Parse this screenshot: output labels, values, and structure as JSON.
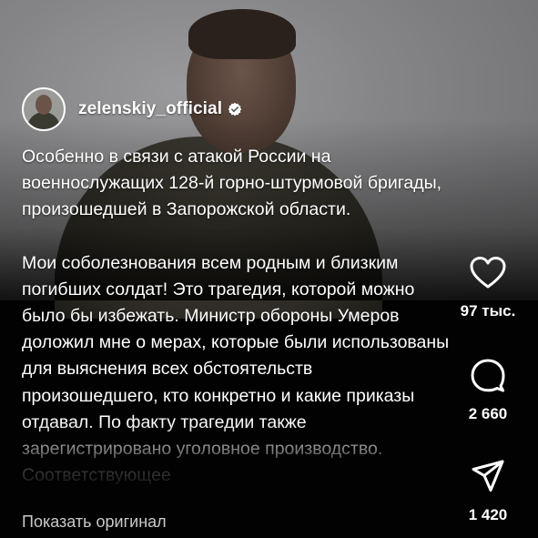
{
  "post": {
    "username": "zelenskiy_official",
    "verified": true,
    "caption_para1": "Особенно в связи с атакой России на военнослужащих 128-й горно-штурмовой бригады, произошедшей в Запорожской области.",
    "caption_para2": "Мои соболезнования всем родным и близким погибших солдат! Это трагедия, которой можно было бы избежать. Министр обороны Умеров доложил мне о мерах, которые были использованы для выяснения всех обстоятельств произошедшего, кто конкретно и какие приказы отдавал. По факту трагедии также зарегистрировано уголовное производство. Соответствующее",
    "show_original": "Показать оригинал"
  },
  "actions": {
    "likes": "97 тыс.",
    "comments": "2 660",
    "shares": "1 420"
  },
  "icons": [
    "heart-icon",
    "comment-icon",
    "share-icon",
    "verified-badge-icon"
  ],
  "colors": {
    "background": "#000000",
    "text": "#ffffff",
    "muted": "#c9c9c9"
  }
}
